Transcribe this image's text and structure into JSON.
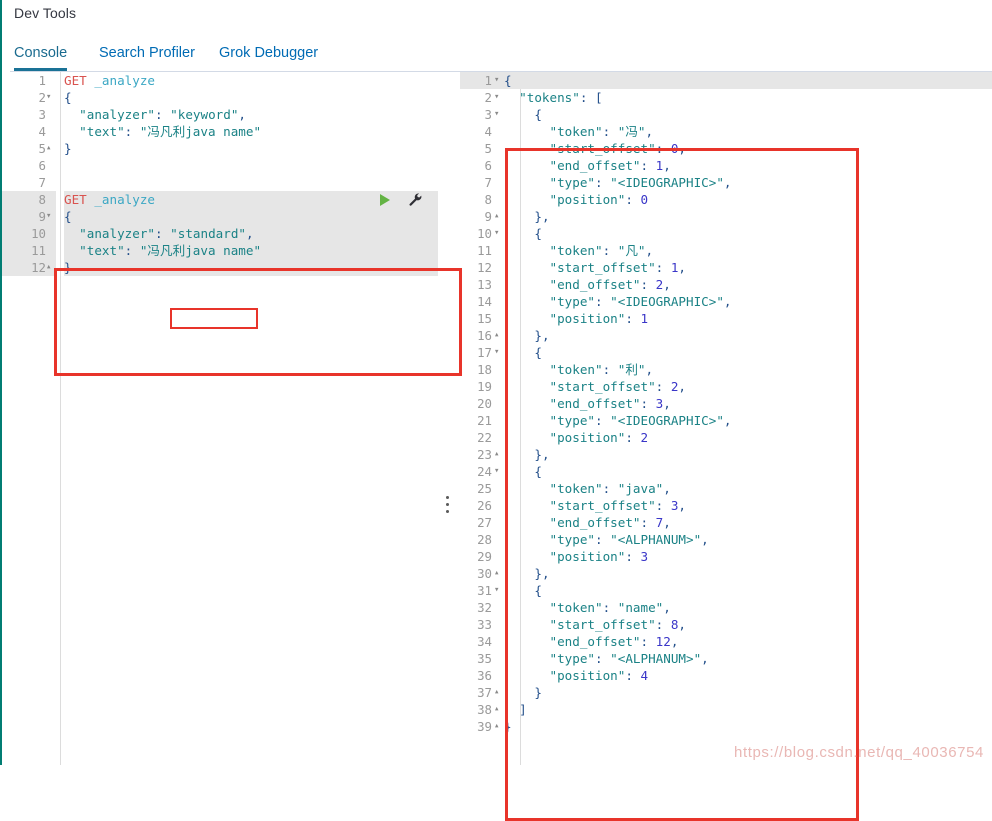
{
  "window": {
    "title": "Dev Tools",
    "accent_color": "#017d73",
    "annotation_color": "#e8342a"
  },
  "tabs": [
    {
      "label": "Console",
      "active": true
    },
    {
      "label": "Search Profiler",
      "active": false
    },
    {
      "label": "Grok Debugger",
      "active": false
    }
  ],
  "editor": {
    "actions": {
      "play_icon": "play-icon",
      "wrench_icon": "wrench-icon"
    },
    "lines": [
      {
        "n": "1",
        "fold": "",
        "highlight": false,
        "tokens": [
          {
            "t": "method",
            "v": "GET"
          },
          {
            "t": "plain",
            "v": " "
          },
          {
            "t": "url",
            "v": "_analyze"
          }
        ]
      },
      {
        "n": "2",
        "fold": "▾",
        "highlight": false,
        "tokens": [
          {
            "t": "brace",
            "v": "{"
          }
        ]
      },
      {
        "n": "3",
        "fold": "",
        "highlight": false,
        "tokens": [
          {
            "t": "plain",
            "v": "  "
          },
          {
            "t": "key",
            "v": "\"analyzer\""
          },
          {
            "t": "punc",
            "v": ": "
          },
          {
            "t": "str",
            "v": "\"keyword\""
          },
          {
            "t": "punc",
            "v": ","
          }
        ]
      },
      {
        "n": "4",
        "fold": "",
        "highlight": false,
        "tokens": [
          {
            "t": "plain",
            "v": "  "
          },
          {
            "t": "key",
            "v": "\"text\""
          },
          {
            "t": "punc",
            "v": ": "
          },
          {
            "t": "str",
            "v": "\"冯凡利java name\""
          }
        ]
      },
      {
        "n": "5",
        "fold": "▴",
        "highlight": false,
        "tokens": [
          {
            "t": "brace",
            "v": "}"
          }
        ]
      },
      {
        "n": "6",
        "fold": "",
        "highlight": false,
        "tokens": []
      },
      {
        "n": "7",
        "fold": "",
        "highlight": false,
        "tokens": []
      },
      {
        "n": "8",
        "fold": "",
        "highlight": true,
        "actions": true,
        "tokens": [
          {
            "t": "method",
            "v": "GET"
          },
          {
            "t": "plain",
            "v": " "
          },
          {
            "t": "url",
            "v": "_analyze"
          }
        ]
      },
      {
        "n": "9",
        "fold": "▾",
        "highlight": true,
        "tokens": [
          {
            "t": "brace",
            "v": "{"
          }
        ]
      },
      {
        "n": "10",
        "fold": "",
        "highlight": true,
        "tokens": [
          {
            "t": "plain",
            "v": "  "
          },
          {
            "t": "key",
            "v": "\"analyzer\""
          },
          {
            "t": "punc",
            "v": ": "
          },
          {
            "t": "str",
            "v": "\"standard\""
          },
          {
            "t": "punc",
            "v": ","
          }
        ]
      },
      {
        "n": "11",
        "fold": "",
        "highlight": true,
        "tokens": [
          {
            "t": "plain",
            "v": "  "
          },
          {
            "t": "key",
            "v": "\"text\""
          },
          {
            "t": "punc",
            "v": ": "
          },
          {
            "t": "str",
            "v": "\"冯凡利java name\""
          }
        ]
      },
      {
        "n": "12",
        "fold": "▴",
        "highlight": true,
        "tokens": [
          {
            "t": "brace",
            "v": "}"
          }
        ]
      }
    ]
  },
  "output": {
    "lines": [
      {
        "n": "1",
        "fold": "▾",
        "highlight": true,
        "tokens": [
          {
            "t": "brace",
            "v": "{"
          }
        ]
      },
      {
        "n": "2",
        "fold": "▾",
        "highlight": false,
        "tokens": [
          {
            "t": "plain",
            "v": "  "
          },
          {
            "t": "key",
            "v": "\"tokens\""
          },
          {
            "t": "punc",
            "v": ": "
          },
          {
            "t": "brace",
            "v": "["
          }
        ]
      },
      {
        "n": "3",
        "fold": "▾",
        "highlight": false,
        "tokens": [
          {
            "t": "plain",
            "v": "    "
          },
          {
            "t": "brace",
            "v": "{"
          }
        ]
      },
      {
        "n": "4",
        "fold": "",
        "highlight": false,
        "tokens": [
          {
            "t": "plain",
            "v": "      "
          },
          {
            "t": "key",
            "v": "\"token\""
          },
          {
            "t": "punc",
            "v": ": "
          },
          {
            "t": "str",
            "v": "\"冯\""
          },
          {
            "t": "punc",
            "v": ","
          }
        ]
      },
      {
        "n": "5",
        "fold": "",
        "highlight": false,
        "tokens": [
          {
            "t": "plain",
            "v": "      "
          },
          {
            "t": "key",
            "v": "\"start_offset\""
          },
          {
            "t": "punc",
            "v": ": "
          },
          {
            "t": "num",
            "v": "0"
          },
          {
            "t": "punc",
            "v": ","
          }
        ]
      },
      {
        "n": "6",
        "fold": "",
        "highlight": false,
        "tokens": [
          {
            "t": "plain",
            "v": "      "
          },
          {
            "t": "key",
            "v": "\"end_offset\""
          },
          {
            "t": "punc",
            "v": ": "
          },
          {
            "t": "num",
            "v": "1"
          },
          {
            "t": "punc",
            "v": ","
          }
        ]
      },
      {
        "n": "7",
        "fold": "",
        "highlight": false,
        "tokens": [
          {
            "t": "plain",
            "v": "      "
          },
          {
            "t": "key",
            "v": "\"type\""
          },
          {
            "t": "punc",
            "v": ": "
          },
          {
            "t": "str",
            "v": "\"<IDEOGRAPHIC>\""
          },
          {
            "t": "punc",
            "v": ","
          }
        ]
      },
      {
        "n": "8",
        "fold": "",
        "highlight": false,
        "tokens": [
          {
            "t": "plain",
            "v": "      "
          },
          {
            "t": "key",
            "v": "\"position\""
          },
          {
            "t": "punc",
            "v": ": "
          },
          {
            "t": "num",
            "v": "0"
          }
        ]
      },
      {
        "n": "9",
        "fold": "▴",
        "highlight": false,
        "tokens": [
          {
            "t": "plain",
            "v": "    "
          },
          {
            "t": "brace",
            "v": "}"
          },
          {
            "t": "punc",
            "v": ","
          }
        ]
      },
      {
        "n": "10",
        "fold": "▾",
        "highlight": false,
        "tokens": [
          {
            "t": "plain",
            "v": "    "
          },
          {
            "t": "brace",
            "v": "{"
          }
        ]
      },
      {
        "n": "11",
        "fold": "",
        "highlight": false,
        "tokens": [
          {
            "t": "plain",
            "v": "      "
          },
          {
            "t": "key",
            "v": "\"token\""
          },
          {
            "t": "punc",
            "v": ": "
          },
          {
            "t": "str",
            "v": "\"凡\""
          },
          {
            "t": "punc",
            "v": ","
          }
        ]
      },
      {
        "n": "12",
        "fold": "",
        "highlight": false,
        "tokens": [
          {
            "t": "plain",
            "v": "      "
          },
          {
            "t": "key",
            "v": "\"start_offset\""
          },
          {
            "t": "punc",
            "v": ": "
          },
          {
            "t": "num",
            "v": "1"
          },
          {
            "t": "punc",
            "v": ","
          }
        ]
      },
      {
        "n": "13",
        "fold": "",
        "highlight": false,
        "tokens": [
          {
            "t": "plain",
            "v": "      "
          },
          {
            "t": "key",
            "v": "\"end_offset\""
          },
          {
            "t": "punc",
            "v": ": "
          },
          {
            "t": "num",
            "v": "2"
          },
          {
            "t": "punc",
            "v": ","
          }
        ]
      },
      {
        "n": "14",
        "fold": "",
        "highlight": false,
        "tokens": [
          {
            "t": "plain",
            "v": "      "
          },
          {
            "t": "key",
            "v": "\"type\""
          },
          {
            "t": "punc",
            "v": ": "
          },
          {
            "t": "str",
            "v": "\"<IDEOGRAPHIC>\""
          },
          {
            "t": "punc",
            "v": ","
          }
        ]
      },
      {
        "n": "15",
        "fold": "",
        "highlight": false,
        "tokens": [
          {
            "t": "plain",
            "v": "      "
          },
          {
            "t": "key",
            "v": "\"position\""
          },
          {
            "t": "punc",
            "v": ": "
          },
          {
            "t": "num",
            "v": "1"
          }
        ]
      },
      {
        "n": "16",
        "fold": "▴",
        "highlight": false,
        "tokens": [
          {
            "t": "plain",
            "v": "    "
          },
          {
            "t": "brace",
            "v": "}"
          },
          {
            "t": "punc",
            "v": ","
          }
        ]
      },
      {
        "n": "17",
        "fold": "▾",
        "highlight": false,
        "tokens": [
          {
            "t": "plain",
            "v": "    "
          },
          {
            "t": "brace",
            "v": "{"
          }
        ]
      },
      {
        "n": "18",
        "fold": "",
        "highlight": false,
        "tokens": [
          {
            "t": "plain",
            "v": "      "
          },
          {
            "t": "key",
            "v": "\"token\""
          },
          {
            "t": "punc",
            "v": ": "
          },
          {
            "t": "str",
            "v": "\"利\""
          },
          {
            "t": "punc",
            "v": ","
          }
        ]
      },
      {
        "n": "19",
        "fold": "",
        "highlight": false,
        "tokens": [
          {
            "t": "plain",
            "v": "      "
          },
          {
            "t": "key",
            "v": "\"start_offset\""
          },
          {
            "t": "punc",
            "v": ": "
          },
          {
            "t": "num",
            "v": "2"
          },
          {
            "t": "punc",
            "v": ","
          }
        ]
      },
      {
        "n": "20",
        "fold": "",
        "highlight": false,
        "tokens": [
          {
            "t": "plain",
            "v": "      "
          },
          {
            "t": "key",
            "v": "\"end_offset\""
          },
          {
            "t": "punc",
            "v": ": "
          },
          {
            "t": "num",
            "v": "3"
          },
          {
            "t": "punc",
            "v": ","
          }
        ]
      },
      {
        "n": "21",
        "fold": "",
        "highlight": false,
        "tokens": [
          {
            "t": "plain",
            "v": "      "
          },
          {
            "t": "key",
            "v": "\"type\""
          },
          {
            "t": "punc",
            "v": ": "
          },
          {
            "t": "str",
            "v": "\"<IDEOGRAPHIC>\""
          },
          {
            "t": "punc",
            "v": ","
          }
        ]
      },
      {
        "n": "22",
        "fold": "",
        "highlight": false,
        "tokens": [
          {
            "t": "plain",
            "v": "      "
          },
          {
            "t": "key",
            "v": "\"position\""
          },
          {
            "t": "punc",
            "v": ": "
          },
          {
            "t": "num",
            "v": "2"
          }
        ]
      },
      {
        "n": "23",
        "fold": "▴",
        "highlight": false,
        "tokens": [
          {
            "t": "plain",
            "v": "    "
          },
          {
            "t": "brace",
            "v": "}"
          },
          {
            "t": "punc",
            "v": ","
          }
        ]
      },
      {
        "n": "24",
        "fold": "▾",
        "highlight": false,
        "tokens": [
          {
            "t": "plain",
            "v": "    "
          },
          {
            "t": "brace",
            "v": "{"
          }
        ]
      },
      {
        "n": "25",
        "fold": "",
        "highlight": false,
        "tokens": [
          {
            "t": "plain",
            "v": "      "
          },
          {
            "t": "key",
            "v": "\"token\""
          },
          {
            "t": "punc",
            "v": ": "
          },
          {
            "t": "str",
            "v": "\"java\""
          },
          {
            "t": "punc",
            "v": ","
          }
        ]
      },
      {
        "n": "26",
        "fold": "",
        "highlight": false,
        "tokens": [
          {
            "t": "plain",
            "v": "      "
          },
          {
            "t": "key",
            "v": "\"start_offset\""
          },
          {
            "t": "punc",
            "v": ": "
          },
          {
            "t": "num",
            "v": "3"
          },
          {
            "t": "punc",
            "v": ","
          }
        ]
      },
      {
        "n": "27",
        "fold": "",
        "highlight": false,
        "tokens": [
          {
            "t": "plain",
            "v": "      "
          },
          {
            "t": "key",
            "v": "\"end_offset\""
          },
          {
            "t": "punc",
            "v": ": "
          },
          {
            "t": "num",
            "v": "7"
          },
          {
            "t": "punc",
            "v": ","
          }
        ]
      },
      {
        "n": "28",
        "fold": "",
        "highlight": false,
        "tokens": [
          {
            "t": "plain",
            "v": "      "
          },
          {
            "t": "key",
            "v": "\"type\""
          },
          {
            "t": "punc",
            "v": ": "
          },
          {
            "t": "str",
            "v": "\"<ALPHANUM>\""
          },
          {
            "t": "punc",
            "v": ","
          }
        ]
      },
      {
        "n": "29",
        "fold": "",
        "highlight": false,
        "tokens": [
          {
            "t": "plain",
            "v": "      "
          },
          {
            "t": "key",
            "v": "\"position\""
          },
          {
            "t": "punc",
            "v": ": "
          },
          {
            "t": "num",
            "v": "3"
          }
        ]
      },
      {
        "n": "30",
        "fold": "▴",
        "highlight": false,
        "tokens": [
          {
            "t": "plain",
            "v": "    "
          },
          {
            "t": "brace",
            "v": "}"
          },
          {
            "t": "punc",
            "v": ","
          }
        ]
      },
      {
        "n": "31",
        "fold": "▾",
        "highlight": false,
        "tokens": [
          {
            "t": "plain",
            "v": "    "
          },
          {
            "t": "brace",
            "v": "{"
          }
        ]
      },
      {
        "n": "32",
        "fold": "",
        "highlight": false,
        "tokens": [
          {
            "t": "plain",
            "v": "      "
          },
          {
            "t": "key",
            "v": "\"token\""
          },
          {
            "t": "punc",
            "v": ": "
          },
          {
            "t": "str",
            "v": "\"name\""
          },
          {
            "t": "punc",
            "v": ","
          }
        ]
      },
      {
        "n": "33",
        "fold": "",
        "highlight": false,
        "tokens": [
          {
            "t": "plain",
            "v": "      "
          },
          {
            "t": "key",
            "v": "\"start_offset\""
          },
          {
            "t": "punc",
            "v": ": "
          },
          {
            "t": "num",
            "v": "8"
          },
          {
            "t": "punc",
            "v": ","
          }
        ]
      },
      {
        "n": "34",
        "fold": "",
        "highlight": false,
        "tokens": [
          {
            "t": "plain",
            "v": "      "
          },
          {
            "t": "key",
            "v": "\"end_offset\""
          },
          {
            "t": "punc",
            "v": ": "
          },
          {
            "t": "num",
            "v": "12"
          },
          {
            "t": "punc",
            "v": ","
          }
        ]
      },
      {
        "n": "35",
        "fold": "",
        "highlight": false,
        "tokens": [
          {
            "t": "plain",
            "v": "      "
          },
          {
            "t": "key",
            "v": "\"type\""
          },
          {
            "t": "punc",
            "v": ": "
          },
          {
            "t": "str",
            "v": "\"<ALPHANUM>\""
          },
          {
            "t": "punc",
            "v": ","
          }
        ]
      },
      {
        "n": "36",
        "fold": "",
        "highlight": false,
        "tokens": [
          {
            "t": "plain",
            "v": "      "
          },
          {
            "t": "key",
            "v": "\"position\""
          },
          {
            "t": "punc",
            "v": ": "
          },
          {
            "t": "num",
            "v": "4"
          }
        ]
      },
      {
        "n": "37",
        "fold": "▴",
        "highlight": false,
        "tokens": [
          {
            "t": "plain",
            "v": "    "
          },
          {
            "t": "brace",
            "v": "}"
          }
        ]
      },
      {
        "n": "38",
        "fold": "▴",
        "highlight": false,
        "tokens": [
          {
            "t": "plain",
            "v": "  "
          },
          {
            "t": "brace",
            "v": "]"
          }
        ]
      },
      {
        "n": "39",
        "fold": "▴",
        "highlight": false,
        "tokens": [
          {
            "t": "brace",
            "v": "}"
          }
        ]
      }
    ]
  },
  "watermark": {
    "text": "https://blog.csdn.net/qq_40036754"
  }
}
